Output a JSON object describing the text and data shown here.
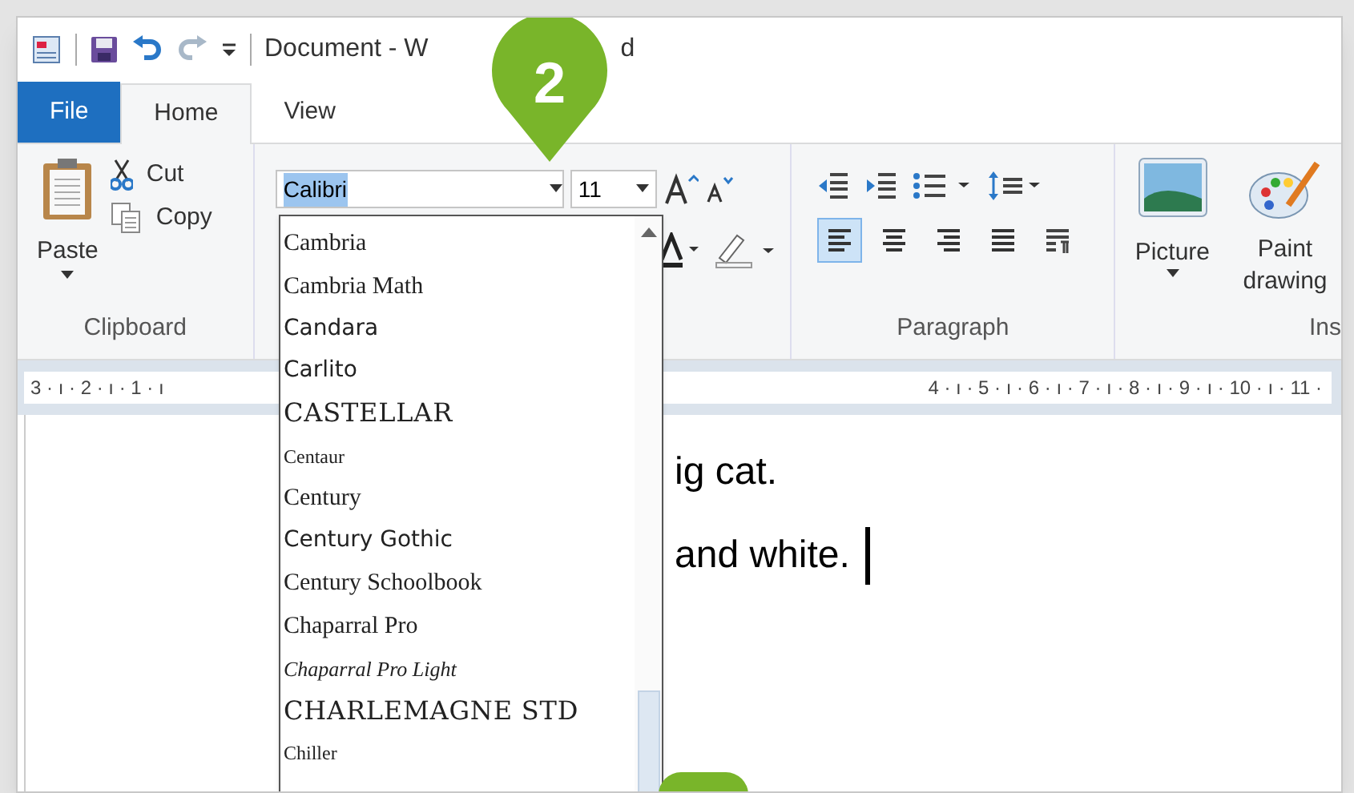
{
  "title_bar": {
    "title": "Document - W",
    "title_tail": "d"
  },
  "tabs": [
    {
      "label": "File",
      "kind": "file",
      "selected": false
    },
    {
      "label": "Home",
      "kind": "tab",
      "selected": true
    },
    {
      "label": "View",
      "kind": "tab",
      "selected": false
    }
  ],
  "clipboard": {
    "paste": "Paste",
    "cut": "Cut",
    "copy": "Copy",
    "label": "Clipboard"
  },
  "font": {
    "name": "Calibri",
    "size": "11"
  },
  "paragraph": {
    "label": "Paragraph",
    "alignments": [
      {
        "kind": "left",
        "selected": true
      },
      {
        "kind": "center",
        "selected": false
      },
      {
        "kind": "right",
        "selected": false
      },
      {
        "kind": "justify",
        "selected": false
      }
    ]
  },
  "insert": {
    "picture": "Picture",
    "paint": "Paint drawing",
    "label": "Ins"
  },
  "ruler": {
    "left": "3 · ı · 2 · ı · 1 · ı",
    "right": "4 · ı · 5 · ı · 6 · ı · 7 · ı · 8 · ı · 9 · ı · 10 · ı · 11 ·"
  },
  "document": {
    "lines": [
      "ig cat.",
      "and white."
    ]
  },
  "font_list": {
    "items": [
      {
        "name": "Cambria",
        "kind": "serif"
      },
      {
        "name": "Cambria Math",
        "kind": "serif"
      },
      {
        "name": "Candara",
        "kind": "sans"
      },
      {
        "name": "Carlito",
        "kind": "sans"
      },
      {
        "name": "CASTELLAR",
        "kind": "display"
      },
      {
        "name": "Centaur",
        "kind": "small-serif"
      },
      {
        "name": "Century",
        "kind": "serif"
      },
      {
        "name": "Century Gothic",
        "kind": "sans"
      },
      {
        "name": "Century Schoolbook",
        "kind": "serif"
      },
      {
        "name": "Chaparral Pro",
        "kind": "serif"
      },
      {
        "name": "Chaparral Pro Light",
        "kind": "italic"
      },
      {
        "name": "CHARLEMAGNE STD",
        "kind": "display"
      },
      {
        "name": "Chiller",
        "kind": "small-serif"
      }
    ]
  },
  "callouts": [
    {
      "label": "2"
    }
  ]
}
